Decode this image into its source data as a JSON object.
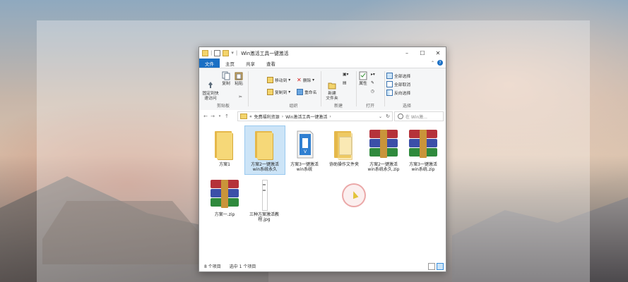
{
  "window": {
    "title": "Win激活工具一键激活"
  },
  "tabs": {
    "file": "文件",
    "home": "主页",
    "share": "共享",
    "view": "查看"
  },
  "ribbon": {
    "clipboard": {
      "label": "剪贴板",
      "pin": "固定到快\n速访问",
      "copy": "复制",
      "paste": "粘贴"
    },
    "organize": {
      "label": "组织",
      "move_to": "移动到",
      "copy_to": "复制到",
      "delete": "删除",
      "rename": "重命名"
    },
    "new": {
      "label": "新建",
      "new_folder": "新建\n文件夹"
    },
    "open": {
      "label": "打开",
      "properties": "属性"
    },
    "select": {
      "label": "选择",
      "select_all": "全部选择",
      "select_none": "全部取消",
      "invert": "反向选择"
    }
  },
  "address": {
    "prefix": "«",
    "crumbs": [
      "免费福利资源",
      "Win激活工具一键激活"
    ],
    "search_placeholder": "在 Win激..."
  },
  "items": [
    {
      "name": "方案1",
      "type": "folder"
    },
    {
      "name": "方案2一键激活\nwin系统永久",
      "type": "folder",
      "selected": true
    },
    {
      "name": "方案3一键激活\nwin系统",
      "type": "app"
    },
    {
      "name": "协助操作文件夹",
      "type": "folder-doc"
    },
    {
      "name": "方案2一键激活\nwin系统永久.zip",
      "type": "rar"
    },
    {
      "name": "方案3一键激活\nwin系统.zip",
      "type": "rar"
    },
    {
      "name": "方案一.zip",
      "type": "rar"
    },
    {
      "name": "三种方案激活教\n程.jpg",
      "type": "image"
    }
  ],
  "status": {
    "count": "8 个项目",
    "selected": "选中 1 个项目"
  },
  "colors": {
    "accent": "#1a6fc4",
    "selection": "#cce4f7"
  }
}
